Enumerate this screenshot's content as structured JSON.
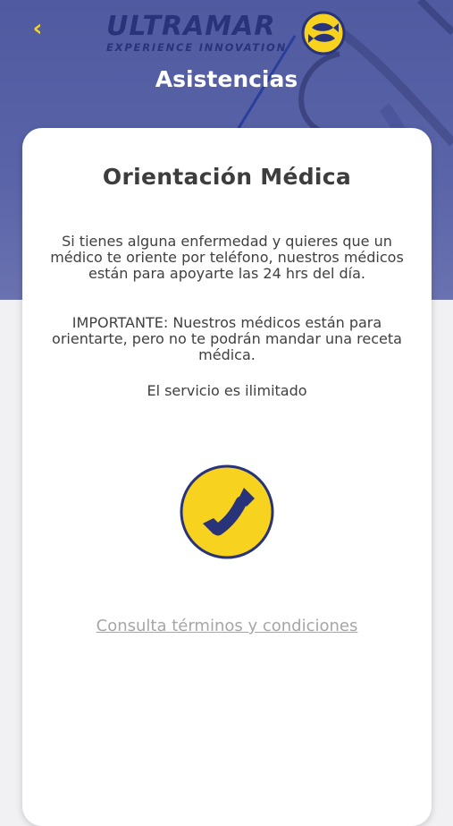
{
  "header": {
    "back_icon": "chevron-left-icon",
    "logo": {
      "name": "ULTRAMAR",
      "tagline": "EXPERIENCE INNOVATION",
      "badge_icon": "fish-badge-icon"
    },
    "title": "Asistencias"
  },
  "card": {
    "title": "Orientación Médica",
    "description": "Si tienes alguna enfermedad y quieres que un médico te oriente por teléfono, nuestros médicos están para apoyarte las 24 hrs del día.",
    "important": "IMPORTANTE: Nuestros médicos están para orientarte, pero no te podrán mandar una receta médica.",
    "service_note": "El servicio es ilimitado",
    "call_button_icon": "phone-icon",
    "terms_link": "Consulta términos y condiciones"
  },
  "colors": {
    "header_bg": "#5a64a8",
    "brand_navy": "#28337a",
    "accent_yellow": "#f7d21f",
    "card_bg": "#ffffff",
    "text": "#404040",
    "link": "#a6a6a6"
  }
}
